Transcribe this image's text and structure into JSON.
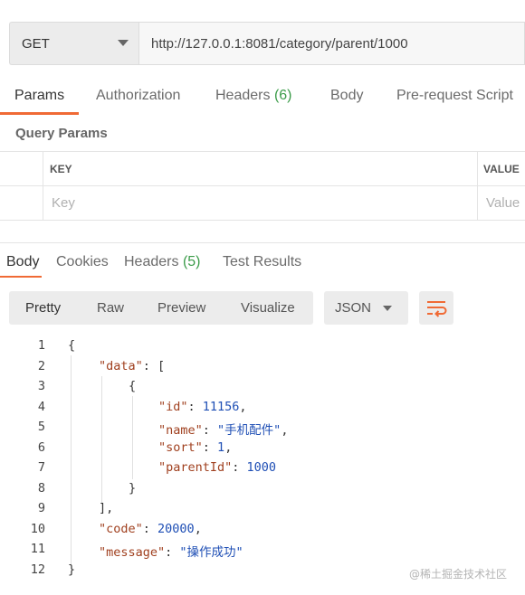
{
  "request": {
    "method": "GET",
    "url": "http://127.0.0.1:8081/category/parent/1000"
  },
  "request_tabs": {
    "params": "Params",
    "authorization": "Authorization",
    "headers": "Headers",
    "headers_count": "(6)",
    "body": "Body",
    "pre_request": "Pre-request Script"
  },
  "query_params": {
    "title": "Query Params",
    "col_key": "KEY",
    "col_value": "VALUE",
    "key_placeholder": "Key",
    "value_placeholder": "Value"
  },
  "response_tabs": {
    "body": "Body",
    "cookies": "Cookies",
    "headers": "Headers",
    "headers_count": "(5)",
    "test_results": "Test Results"
  },
  "view_modes": {
    "pretty": "Pretty",
    "raw": "Raw",
    "preview": "Preview",
    "visualize": "Visualize",
    "format": "JSON"
  },
  "code": {
    "line_numbers": [
      "1",
      "2",
      "3",
      "4",
      "5",
      "6",
      "7",
      "8",
      "9",
      "10",
      "11",
      "12"
    ],
    "open_brace": "{",
    "data_key": "\"data\"",
    "data_open": "[",
    "item_open": "{",
    "id_key": "\"id\"",
    "id_val": "11156",
    "name_key": "\"name\"",
    "name_val": "\"手机配件\"",
    "sort_key": "\"sort\"",
    "sort_val": "1",
    "parent_key": "\"parentId\"",
    "parent_val": "1000",
    "item_close": "}",
    "data_close": "],",
    "code_key": "\"code\"",
    "code_val": "20000",
    "message_key": "\"message\"",
    "message_val": "\"操作成功\"",
    "close_brace": "}"
  },
  "watermark": "@稀土掘金技术社区"
}
